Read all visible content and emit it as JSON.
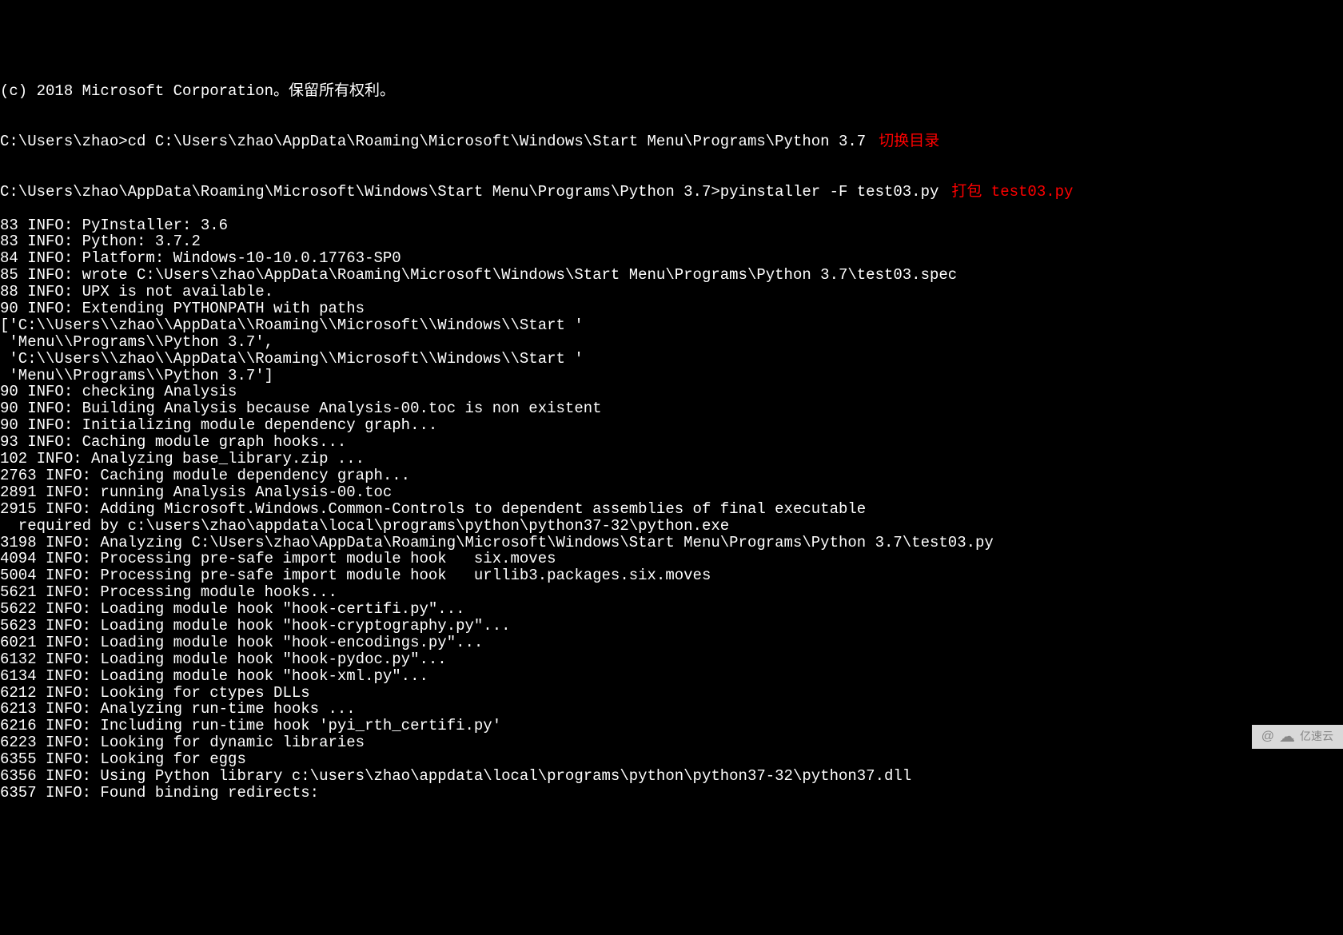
{
  "terminal": {
    "copyright": "(c) 2018 Microsoft Corporation。保留所有权利。",
    "blank1": "",
    "cd_line": "C:\\Users\\zhao>cd C:\\Users\\zhao\\AppData\\Roaming\\Microsoft\\Windows\\Start Menu\\Programs\\Python 3.7",
    "cd_annotation": "切换目录",
    "blank2": "",
    "pyinstaller_line": "C:\\Users\\zhao\\AppData\\Roaming\\Microsoft\\Windows\\Start Menu\\Programs\\Python 3.7>pyinstaller -F test03.py",
    "pyinstaller_annotation": "打包 test03.py",
    "lines": [
      "83 INFO: PyInstaller: 3.6",
      "83 INFO: Python: 3.7.2",
      "84 INFO: Platform: Windows-10-10.0.17763-SP0",
      "85 INFO: wrote C:\\Users\\zhao\\AppData\\Roaming\\Microsoft\\Windows\\Start Menu\\Programs\\Python 3.7\\test03.spec",
      "88 INFO: UPX is not available.",
      "90 INFO: Extending PYTHONPATH with paths",
      "['C:\\\\Users\\\\zhao\\\\AppData\\\\Roaming\\\\Microsoft\\\\Windows\\\\Start '",
      " 'Menu\\\\Programs\\\\Python 3.7',",
      " 'C:\\\\Users\\\\zhao\\\\AppData\\\\Roaming\\\\Microsoft\\\\Windows\\\\Start '",
      " 'Menu\\\\Programs\\\\Python 3.7']",
      "90 INFO: checking Analysis",
      "90 INFO: Building Analysis because Analysis-00.toc is non existent",
      "90 INFO: Initializing module dependency graph...",
      "93 INFO: Caching module graph hooks...",
      "102 INFO: Analyzing base_library.zip ...",
      "2763 INFO: Caching module dependency graph...",
      "2891 INFO: running Analysis Analysis-00.toc",
      "2915 INFO: Adding Microsoft.Windows.Common-Controls to dependent assemblies of final executable",
      "  required by c:\\users\\zhao\\appdata\\local\\programs\\python\\python37-32\\python.exe",
      "3198 INFO: Analyzing C:\\Users\\zhao\\AppData\\Roaming\\Microsoft\\Windows\\Start Menu\\Programs\\Python 3.7\\test03.py",
      "4094 INFO: Processing pre-safe import module hook   six.moves",
      "5004 INFO: Processing pre-safe import module hook   urllib3.packages.six.moves",
      "5621 INFO: Processing module hooks...",
      "5622 INFO: Loading module hook \"hook-certifi.py\"...",
      "5623 INFO: Loading module hook \"hook-cryptography.py\"...",
      "6021 INFO: Loading module hook \"hook-encodings.py\"...",
      "6132 INFO: Loading module hook \"hook-pydoc.py\"...",
      "6134 INFO: Loading module hook \"hook-xml.py\"...",
      "6212 INFO: Looking for ctypes DLLs",
      "6213 INFO: Analyzing run-time hooks ...",
      "6216 INFO: Including run-time hook 'pyi_rth_certifi.py'",
      "6223 INFO: Looking for dynamic libraries",
      "6355 INFO: Looking for eggs",
      "6356 INFO: Using Python library c:\\users\\zhao\\appdata\\local\\programs\\python\\python37-32\\python37.dll",
      "6357 INFO: Found binding redirects:"
    ]
  },
  "watermark": {
    "text": "亿速云"
  }
}
